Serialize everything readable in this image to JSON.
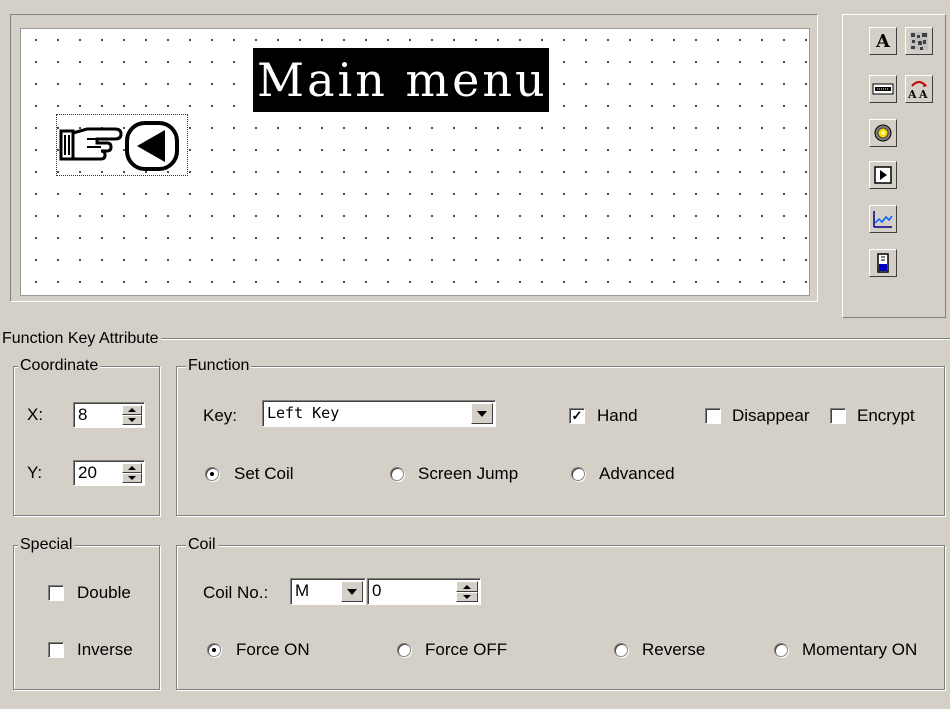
{
  "canvas": {
    "title": "Main menu"
  },
  "toolbox": {
    "buttons": [
      "text-tool-icon",
      "bitmap-tool-icon",
      "data-display-icon",
      "font-size-icon",
      "lamp-icon",
      "function-key-icon",
      "trend-chart-icon",
      "bar-meter-icon"
    ]
  },
  "attributes": {
    "title": "Function Key Attribute",
    "coordinate": {
      "label": "Coordinate",
      "x_label": "X:",
      "x_value": "8",
      "y_label": "Y:",
      "y_value": "20"
    },
    "function": {
      "label": "Function",
      "key_label": "Key:",
      "key_value": "Left Key",
      "hand_label": "Hand",
      "hand_checked": true,
      "disappear_label": "Disappear",
      "encrypt_label": "Encrypt",
      "set_coil_label": "Set Coil",
      "screen_jump_label": "Screen Jump",
      "advanced_label": "Advanced"
    },
    "special": {
      "label": "Special",
      "double_label": "Double",
      "inverse_label": "Inverse"
    },
    "coil": {
      "label": "Coil",
      "coil_no_label": "Coil No.:",
      "coil_type": "M",
      "coil_no_value": "0",
      "force_on_label": "Force ON",
      "force_off_label": "Force OFF",
      "reverse_label": "Reverse",
      "momentary_on_label": "Momentary ON"
    }
  }
}
